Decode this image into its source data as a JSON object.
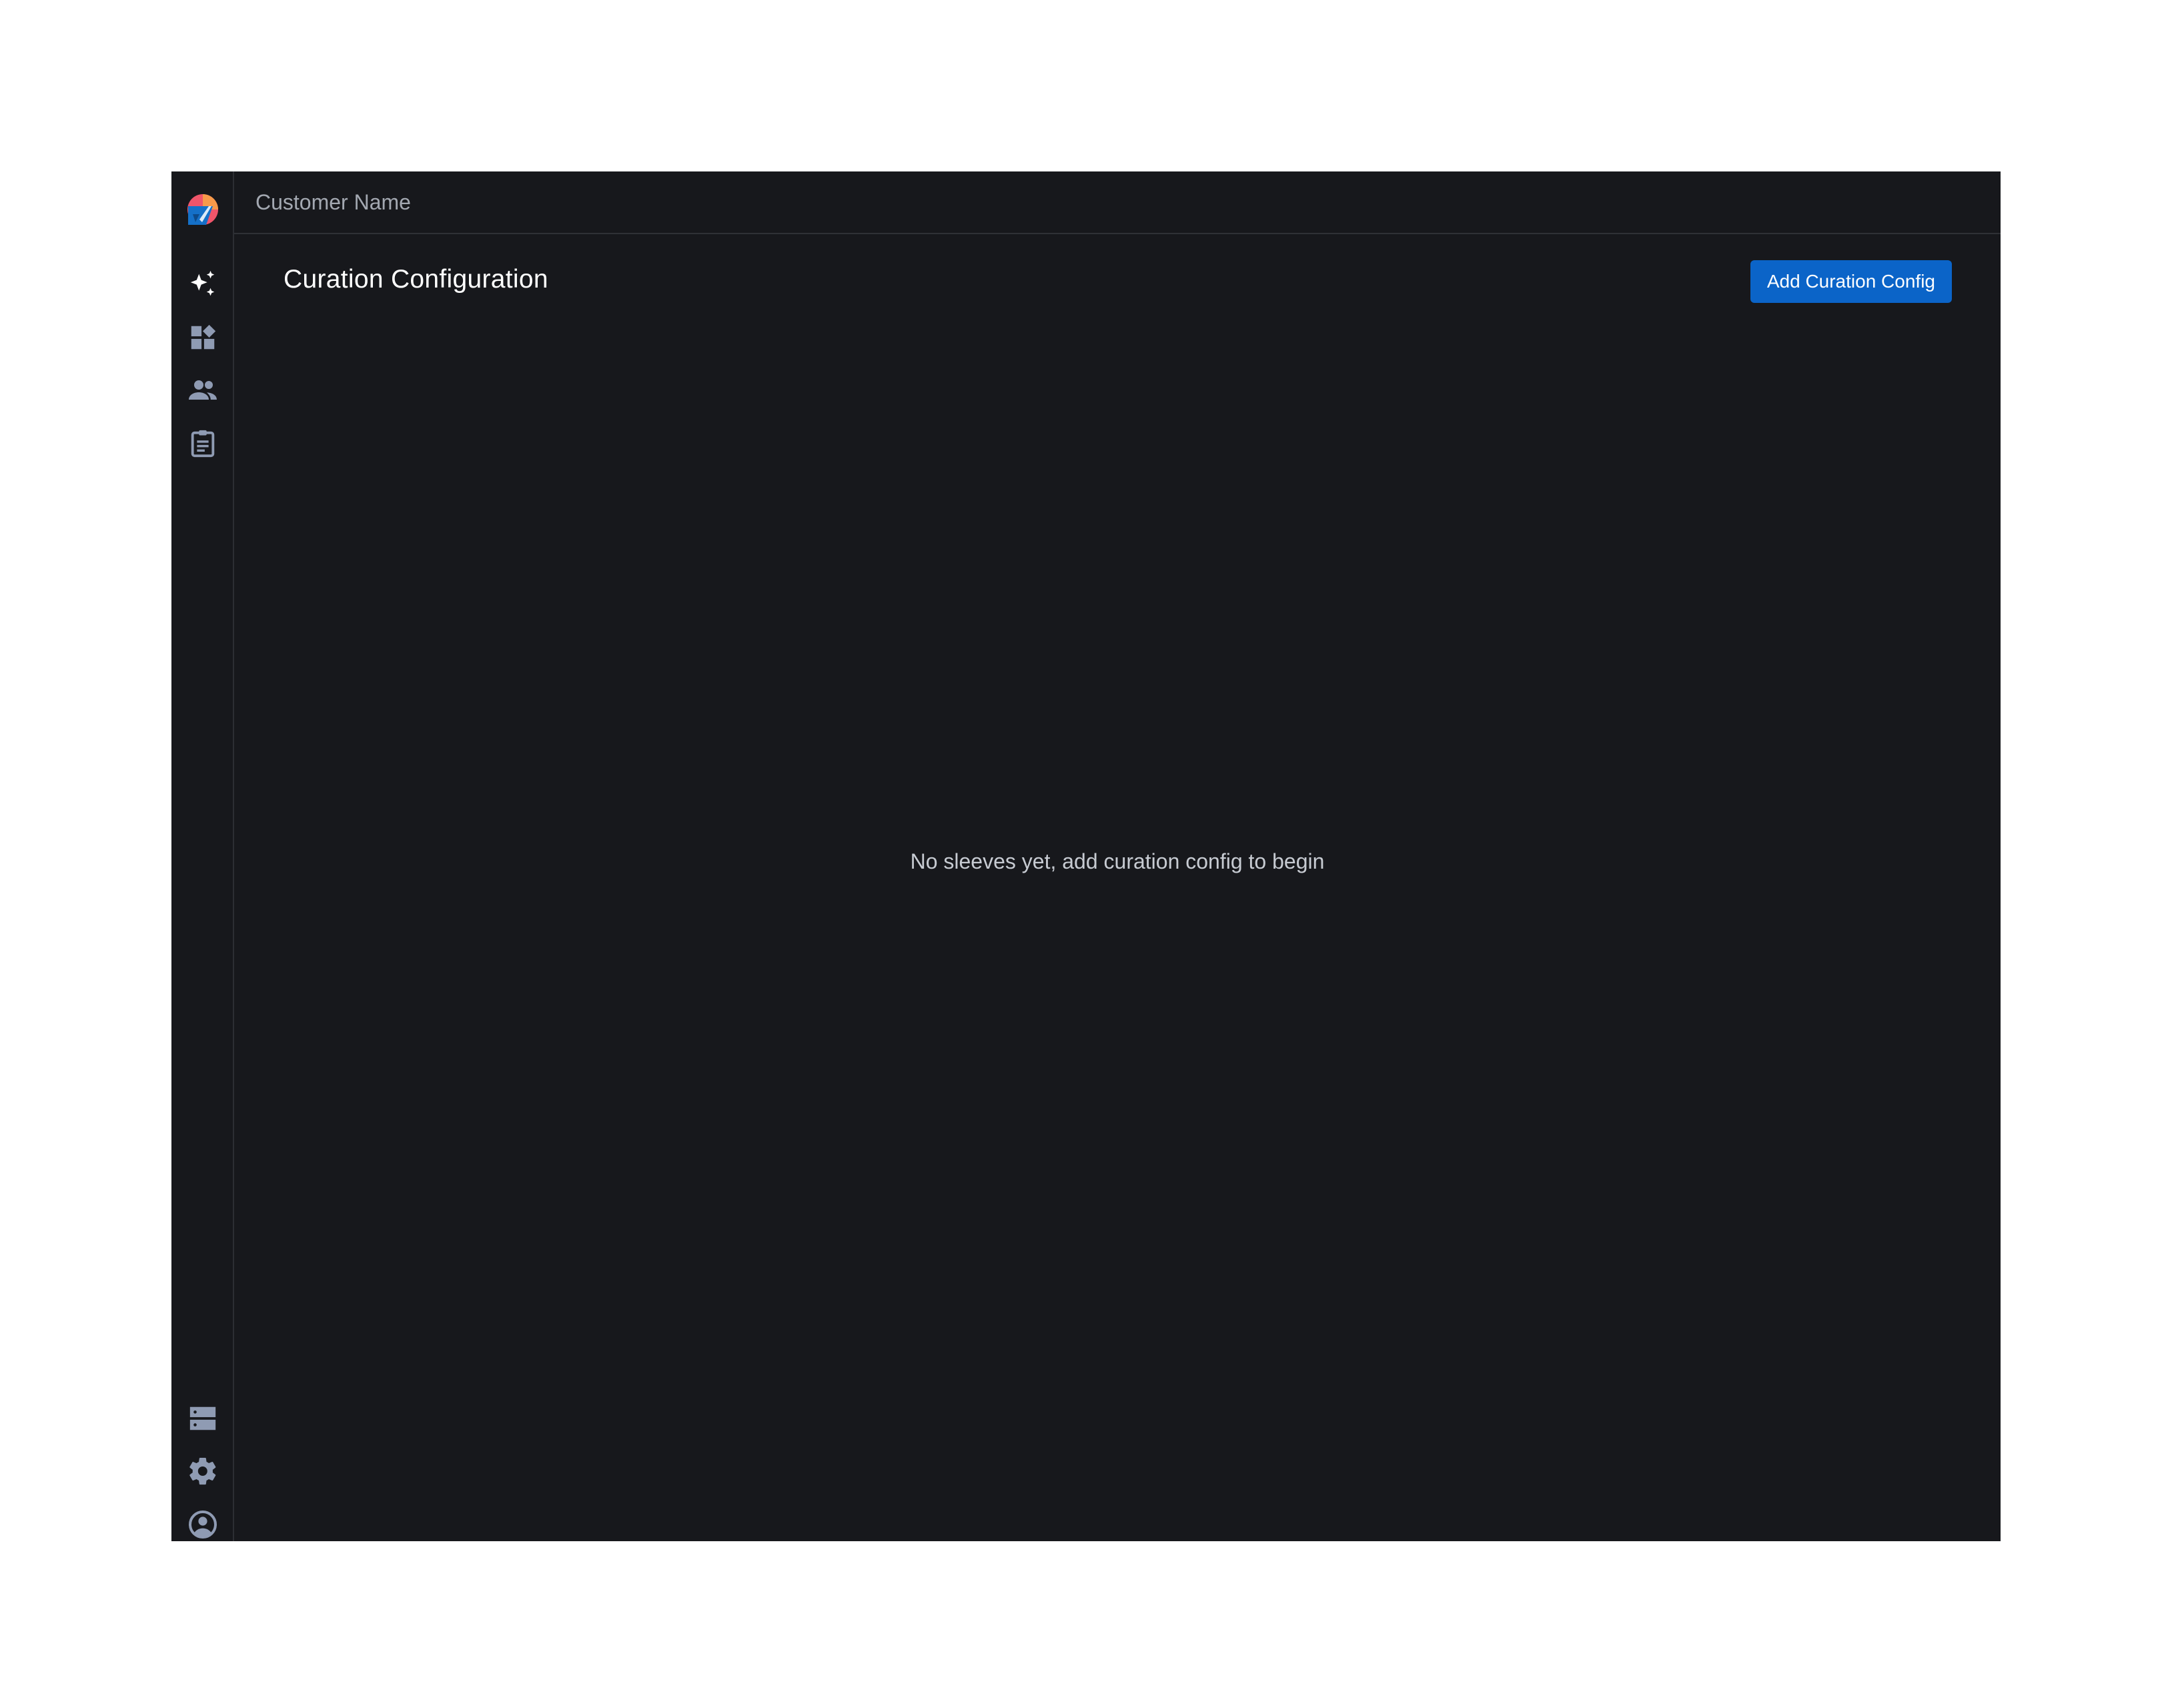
{
  "header": {
    "customer_name": "Customer Name"
  },
  "page": {
    "title": "Curation Configuration",
    "add_button_label": "Add Curation Config",
    "empty_message": "No sleeves yet, add curation config to begin"
  },
  "sidebar": {
    "logo": "app-logo",
    "top_items": [
      {
        "icon": "sparkles-icon"
      },
      {
        "icon": "dashboard-icon"
      },
      {
        "icon": "people-icon"
      },
      {
        "icon": "clipboard-icon"
      }
    ],
    "bottom_items": [
      {
        "icon": "storage-icon"
      },
      {
        "icon": "gear-icon"
      },
      {
        "icon": "account-circle-icon"
      }
    ]
  },
  "colors": {
    "background": "#17181c",
    "border": "#2f3136",
    "icon": "#8f9bb3",
    "accent": "#0b64c8",
    "text_muted": "#a3a8b1",
    "text_body": "#c7cbd2",
    "title": "#ffffff"
  }
}
